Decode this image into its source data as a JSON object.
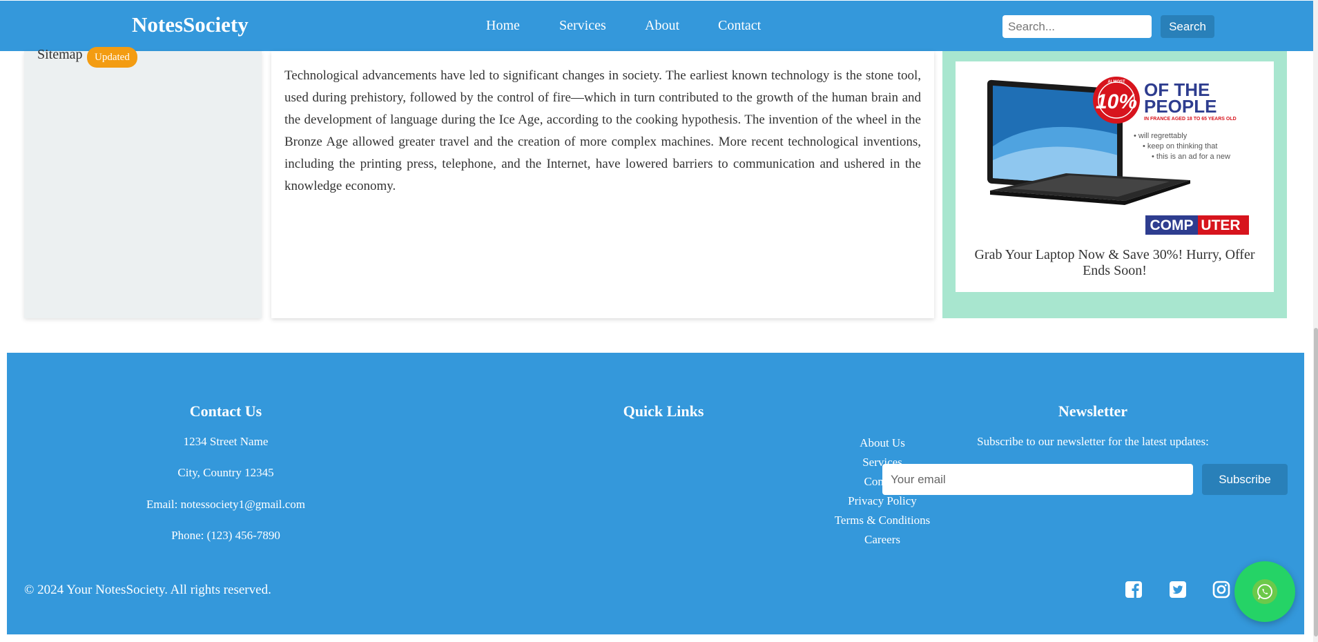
{
  "header": {
    "brand": "NotesSociety",
    "nav": [
      {
        "label": "Home"
      },
      {
        "label": "Services"
      },
      {
        "label": "About"
      },
      {
        "label": "Contact"
      }
    ],
    "search_placeholder": "Search...",
    "search_button": "Search"
  },
  "sidebar": {
    "sitemap_label": "Sitemap",
    "badge": "Updated"
  },
  "article": {
    "text": "Technological advancements have led to significant changes in society. The earliest known technology is the stone tool, used during prehistory, followed by the control of fire—which in turn contributed to the growth of the human brain and the development of language during the Ice Age, according to the cooking hypothesis. The invention of the wheel in the Bronze Age allowed greater travel and the creation of more complex machines. More recent technological inventions, including the printing press, telephone, and the Internet, have lowered barriers to communication and ushered in the knowledge economy."
  },
  "ad": {
    "image_text": {
      "almost": "ALMOST",
      "percent": "10%",
      "headline_1": "OF THE",
      "headline_2": "PEOPLE",
      "subline": "IN FRANCE AGED 18 TO 65 YEARS OLD",
      "bullet_1": "• will regrettably",
      "bullet_2": "• keep on thinking that",
      "bullet_3": "• this is an ad for a new",
      "brand_1": "COMP",
      "brand_2": "UTER"
    },
    "caption": "Grab Your Laptop Now & Save 30%! Hurry, Offer Ends Soon!"
  },
  "footer": {
    "contact": {
      "title": "Contact Us",
      "street": "1234 Street Name",
      "city": "City, Country 12345",
      "email": "Email: notessociety1@gmail.com",
      "phone": "Phone: (123) 456-7890"
    },
    "quick_links": {
      "title": "Quick Links",
      "links": [
        {
          "label": "About Us"
        },
        {
          "label": "Services"
        },
        {
          "label": "Contact"
        },
        {
          "label": "Privacy Policy"
        },
        {
          "label": "Terms & Conditions"
        },
        {
          "label": "Careers"
        }
      ]
    },
    "newsletter": {
      "title": "Newsletter",
      "subtitle": "Subscribe to our newsletter for the latest updates:",
      "email_placeholder": "Your email",
      "button": "Subscribe"
    },
    "copyright": "© 2024 Your NotesSociety. All rights reserved.",
    "social_icons": [
      "facebook-icon",
      "twitter-icon",
      "instagram-icon"
    ]
  },
  "floating": {
    "icon": "whatsapp-icon"
  },
  "colors": {
    "primary": "#3498db",
    "primary_dark": "#2980b9",
    "badge": "#f39c12",
    "ad_bg": "#a8e6cf",
    "sidebar_bg": "#ecf0f1",
    "whatsapp": "#25d366"
  }
}
